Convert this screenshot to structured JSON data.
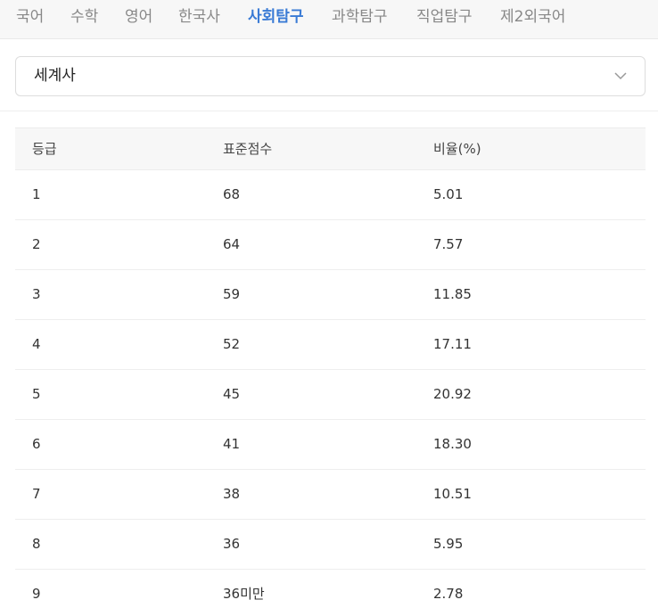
{
  "tabs": [
    {
      "label": "국어",
      "active": false
    },
    {
      "label": "수학",
      "active": false
    },
    {
      "label": "영어",
      "active": false
    },
    {
      "label": "한국사",
      "active": false
    },
    {
      "label": "사회탐구",
      "active": true
    },
    {
      "label": "과학탐구",
      "active": false
    },
    {
      "label": "직업탐구",
      "active": false
    },
    {
      "label": "제2외국어",
      "active": false
    }
  ],
  "subject_select": {
    "value": "세계사",
    "icon": "chevron-down-icon"
  },
  "table": {
    "headers": [
      "등급",
      "표준점수",
      "비율(%)"
    ],
    "rows": [
      {
        "grade": "1",
        "score": "68",
        "ratio": "5.01"
      },
      {
        "grade": "2",
        "score": "64",
        "ratio": "7.57"
      },
      {
        "grade": "3",
        "score": "59",
        "ratio": "11.85"
      },
      {
        "grade": "4",
        "score": "52",
        "ratio": "17.11"
      },
      {
        "grade": "5",
        "score": "45",
        "ratio": "20.92"
      },
      {
        "grade": "6",
        "score": "41",
        "ratio": "18.30"
      },
      {
        "grade": "7",
        "score": "38",
        "ratio": "10.51"
      },
      {
        "grade": "8",
        "score": "36",
        "ratio": "5.95"
      },
      {
        "grade": "9",
        "score": "36미만",
        "ratio": "2.78"
      }
    ]
  },
  "colors": {
    "active_tab": "#3a7bd5",
    "inactive_tab": "#888888",
    "tabbar_bg": "#f7f7f7",
    "header_bg": "#f7f7f7"
  }
}
